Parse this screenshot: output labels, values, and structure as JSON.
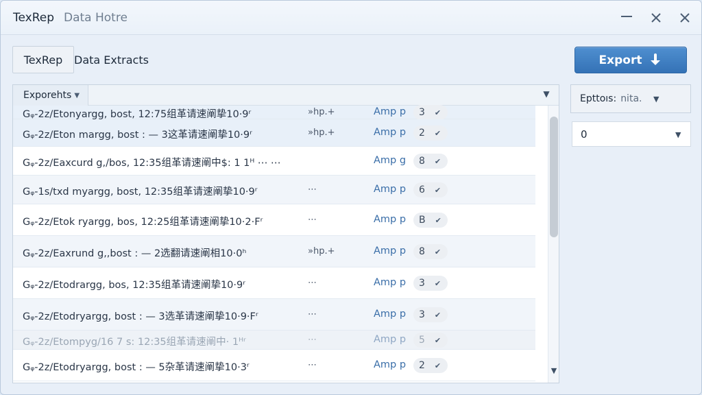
{
  "window": {
    "app_name": "TexRep",
    "subtitle": "Data Hotre",
    "minimize_icon": "minimize-icon",
    "close_icon": "close-icon"
  },
  "toolbar": {
    "tab_label": "TexRep",
    "section_title": "Data Extracts",
    "export_label": "Export",
    "export_icon": "arrow-down-icon",
    "accent_color": "#3a78bd"
  },
  "list": {
    "sort_label": "Exporehts",
    "rows": [
      {
        "name": "Gᵩ-2z/Etonyargg, bost, 12:75组革请速阐挚10·9ʳ",
        "meta": "»hp.+",
        "type": "Amp p",
        "count": "3",
        "faded": false
      },
      {
        "name": "Gᵩ-2z/Eton margg, bost : — 3这革请速阐挚10·9ʳ",
        "meta": "»hp.+",
        "type": "Amp p",
        "count": "2",
        "faded": false
      },
      {
        "name": "Gᵩ-2z/Eaxcurd g,/bos, 12:35组革请速阐中$: 1 1ᴴ ⋯ ⋯",
        "meta": "",
        "type": "Amp g",
        "count": "8",
        "faded": false
      },
      {
        "name": "Gᵩ-1s/txd myargg, bost, 12:35组革请速阐挚10·9ʳ",
        "meta": "⋯",
        "type": "Amp p",
        "count": "6",
        "faded": false
      },
      {
        "name": "Gᵩ-2z/Etok ryargg, bos, 12:25组革请速阐挚10·2·Fʳ",
        "meta": "⋯",
        "type": "Amp p",
        "count": "B",
        "faded": false
      },
      {
        "name": "Gᵩ-2z/Eaxrund g,,bost : — 2选翻请速阐相10·0ʰ",
        "meta": "»hp.+",
        "type": "Amp p",
        "count": "8",
        "faded": false
      },
      {
        "name": "Gᵩ-2z/Etodrargg, bos, 12:35组革请速阐挚10·9ʳ",
        "meta": "⋯",
        "type": "Amp p",
        "count": "3",
        "faded": false
      },
      {
        "name": "Gᵩ-2z/Etodryargg, bost : — 3选革请速阐挚10·9·Fʳ",
        "meta": "⋯",
        "type": "Amp p",
        "count": "3",
        "faded": false
      },
      {
        "name": "Gᵩ-2z/Etompyg/16 7 s: 12:35组革请速阐中· 1ᴴʳ",
        "meta": "⋯",
        "type": "Amp p",
        "count": "5",
        "faded": true
      },
      {
        "name": "Gᵩ-2z/Etodryargg, bost : — 5杂革请速阐挚10·3ʳ",
        "meta": "⋯",
        "type": "Amp p",
        "count": "2",
        "faded": false
      }
    ]
  },
  "side": {
    "options_label": "Epttoıs:",
    "options_value": "nita.",
    "select_value": "0"
  }
}
